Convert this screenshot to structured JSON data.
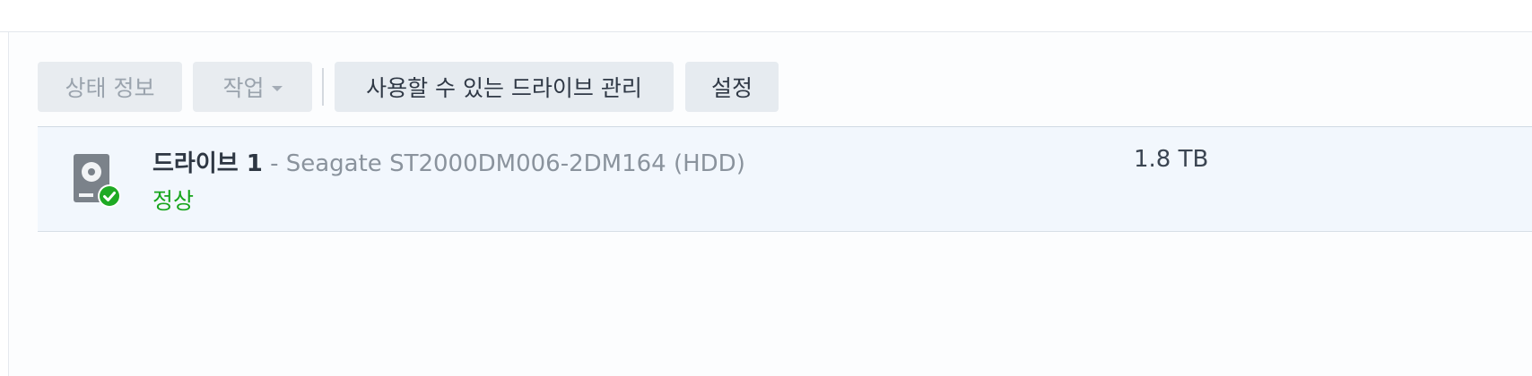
{
  "toolbar": {
    "status_info": "상태 정보",
    "action": "작업",
    "manage_drives": "사용할 수 있는 드라이브 관리",
    "settings": "설정"
  },
  "drive": {
    "name": "드라이브 1",
    "model": " - Seagate ST2000DM006-2DM164 (HDD)",
    "status": "정상",
    "size": "1.8 TB",
    "icon": "hdd-icon",
    "status_badge_icon": "check-circle-icon"
  },
  "colors": {
    "status_ok": "#17a51c",
    "row_highlight": "#f2f7fd",
    "button_bg": "#e6ebf0"
  }
}
